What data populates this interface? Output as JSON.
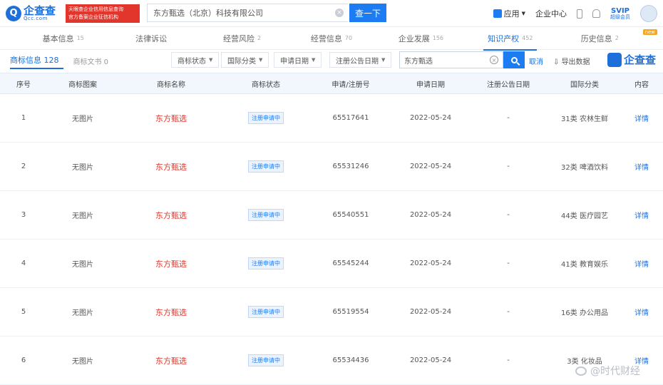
{
  "header": {
    "logo_main": "企查查",
    "logo_sub": "Qcc.com",
    "badge_line1": "天眼查企业信用信息查询",
    "badge_line2": "官方备案企业征信机构",
    "search_value": "东方甄选（北京）科技有限公司",
    "search_button": "查一下",
    "app_label": "应用",
    "enterprise_center": "企业中心",
    "svip_top": "SVIP",
    "svip_bot": "超级会员"
  },
  "tabs": [
    {
      "label": "基本信息",
      "count": "15"
    },
    {
      "label": "法律诉讼",
      "count": ""
    },
    {
      "label": "经营风险",
      "count": "2"
    },
    {
      "label": "经营信息",
      "count": "70"
    },
    {
      "label": "企业发展",
      "count": "156"
    },
    {
      "label": "知识产权",
      "count": "452"
    },
    {
      "label": "历史信息",
      "count": "2"
    }
  ],
  "filters": {
    "subtab_active": "商标信息 128",
    "subtab_other": "商标文书 0",
    "dropdowns": [
      "商标状态",
      "国际分类",
      "申请日期",
      "注册公告日期"
    ],
    "search_value": "东方甄选",
    "cancel": "取消",
    "export": "导出数据",
    "brand": "企查查"
  },
  "table": {
    "headers": [
      "序号",
      "商标图案",
      "商标名称",
      "商标状态",
      "申请/注册号",
      "申请日期",
      "注册公告日期",
      "国际分类",
      "内容"
    ],
    "rows": [
      {
        "idx": "1",
        "pic": "无图片",
        "name": "东方甄选",
        "status": "注册申请中",
        "no": "65517641",
        "date": "2022-05-24",
        "pub": "-",
        "cls": "31类 农林生鲜",
        "detail": "详情"
      },
      {
        "idx": "2",
        "pic": "无图片",
        "name": "东方甄选",
        "status": "注册申请中",
        "no": "65531246",
        "date": "2022-05-24",
        "pub": "-",
        "cls": "32类 啤酒饮料",
        "detail": "详情"
      },
      {
        "idx": "3",
        "pic": "无图片",
        "name": "东方甄选",
        "status": "注册申请中",
        "no": "65540551",
        "date": "2022-05-24",
        "pub": "-",
        "cls": "44类 医疗园艺",
        "detail": "详情"
      },
      {
        "idx": "4",
        "pic": "无图片",
        "name": "东方甄选",
        "status": "注册申请中",
        "no": "65545244",
        "date": "2022-05-24",
        "pub": "-",
        "cls": "41类 教育娱乐",
        "detail": "详情"
      },
      {
        "idx": "5",
        "pic": "无图片",
        "name": "东方甄选",
        "status": "注册申请中",
        "no": "65519554",
        "date": "2022-05-24",
        "pub": "-",
        "cls": "16类 办公用品",
        "detail": "详情"
      },
      {
        "idx": "6",
        "pic": "无图片",
        "name": "东方甄选",
        "status": "注册申请中",
        "no": "65534436",
        "date": "2022-05-24",
        "pub": "-",
        "cls": "3类 化妆品",
        "detail": "详情"
      }
    ]
  },
  "watermark": "@时代财经"
}
